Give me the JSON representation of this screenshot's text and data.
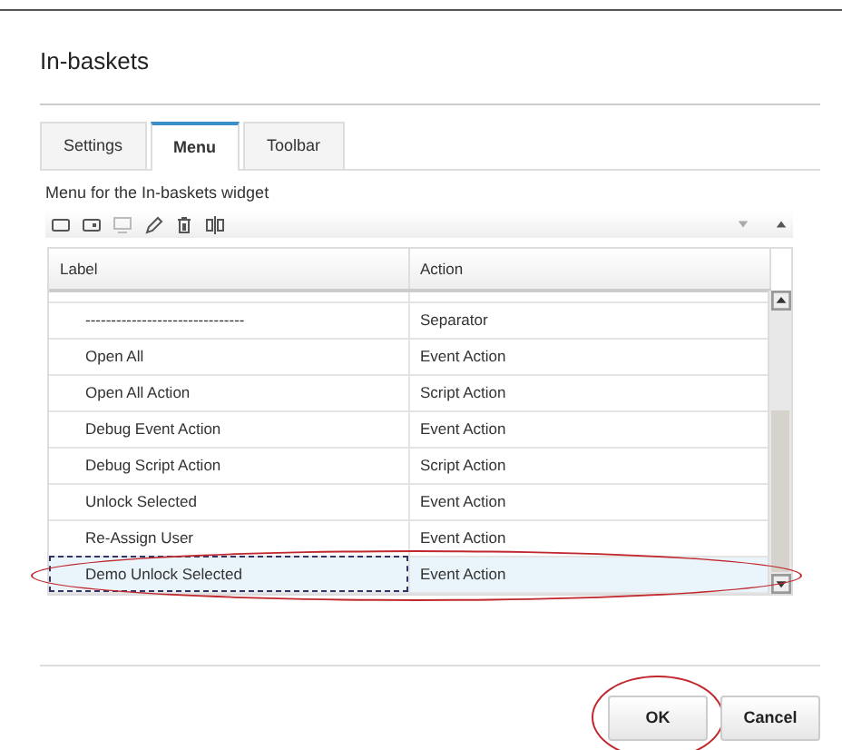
{
  "dialog": {
    "title": "In-baskets"
  },
  "tabs": [
    {
      "label": "Settings",
      "selected": false
    },
    {
      "label": "Menu",
      "selected": true
    },
    {
      "label": "Toolbar",
      "selected": false
    }
  ],
  "menu_caption": "Menu for the In-baskets widget",
  "toolbar": [
    {
      "kind": "add",
      "disabled": false
    },
    {
      "kind": "add-menu",
      "disabled": false
    },
    {
      "kind": "add-sub",
      "disabled": true
    },
    {
      "kind": "edit",
      "disabled": false
    },
    {
      "kind": "delete",
      "disabled": false
    },
    {
      "kind": "separator",
      "disabled": false
    }
  ],
  "table": {
    "columns": [
      "Label",
      "Action"
    ],
    "rows": [
      {
        "label": "-------------------------------",
        "action": "Separator",
        "selected": false,
        "highlighted": false
      },
      {
        "label": "Open All",
        "action": "Event Action",
        "selected": false,
        "highlighted": false
      },
      {
        "label": "Open All Action",
        "action": "Script Action",
        "selected": false,
        "highlighted": false
      },
      {
        "label": "Debug Event Action",
        "action": "Event Action",
        "selected": false,
        "highlighted": false
      },
      {
        "label": "Debug Script Action",
        "action": "Script Action",
        "selected": false,
        "highlighted": false
      },
      {
        "label": "Unlock Selected",
        "action": "Event Action",
        "selected": false,
        "highlighted": false
      },
      {
        "label": "Re-Assign User",
        "action": "Event Action",
        "selected": false,
        "highlighted": false
      },
      {
        "label": "Demo Unlock Selected",
        "action": "Event Action",
        "selected": true,
        "highlighted": true
      }
    ]
  },
  "buttons": [
    {
      "label": "OK",
      "highlighted": true
    },
    {
      "label": "Cancel",
      "highlighted": false
    }
  ]
}
